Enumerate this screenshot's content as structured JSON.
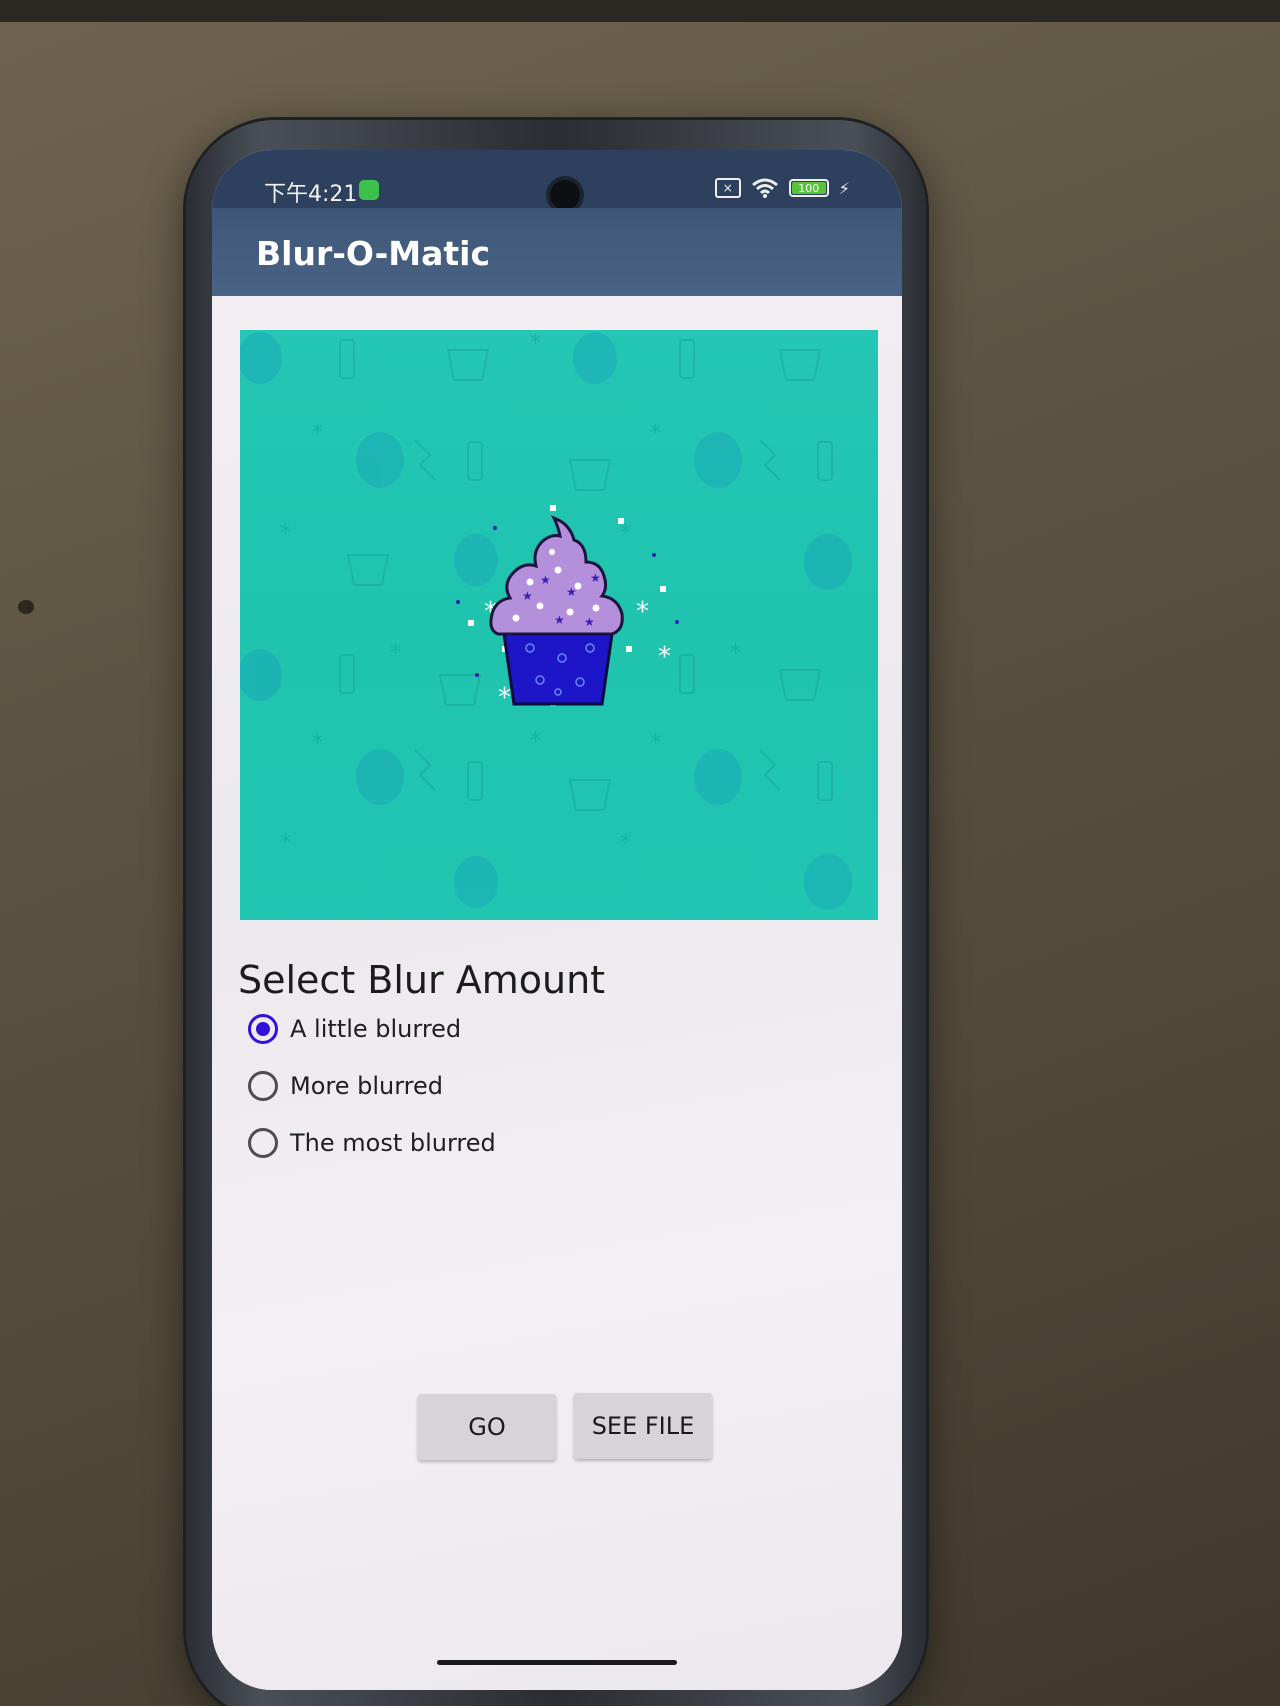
{
  "status_bar": {
    "time": "下午4:21",
    "battery": "100",
    "icons": [
      "app-notification-icon",
      "sim-off-icon",
      "wifi-icon",
      "battery-icon",
      "charging-icon"
    ]
  },
  "app_bar": {
    "title": "Blur-O-Matic",
    "color": "#3e5677"
  },
  "hero_image": {
    "subject": "cupcake-illustration",
    "background_color": "#21c5b1"
  },
  "blur_section": {
    "title": "Select Blur Amount",
    "options": [
      {
        "label": "A little blurred",
        "checked": true
      },
      {
        "label": "More blurred",
        "checked": false
      },
      {
        "label": "The most blurred",
        "checked": false
      }
    ],
    "accent_color": "#3212d8"
  },
  "buttons": {
    "go_label": "GO",
    "see_file_label": "SEE FILE"
  }
}
